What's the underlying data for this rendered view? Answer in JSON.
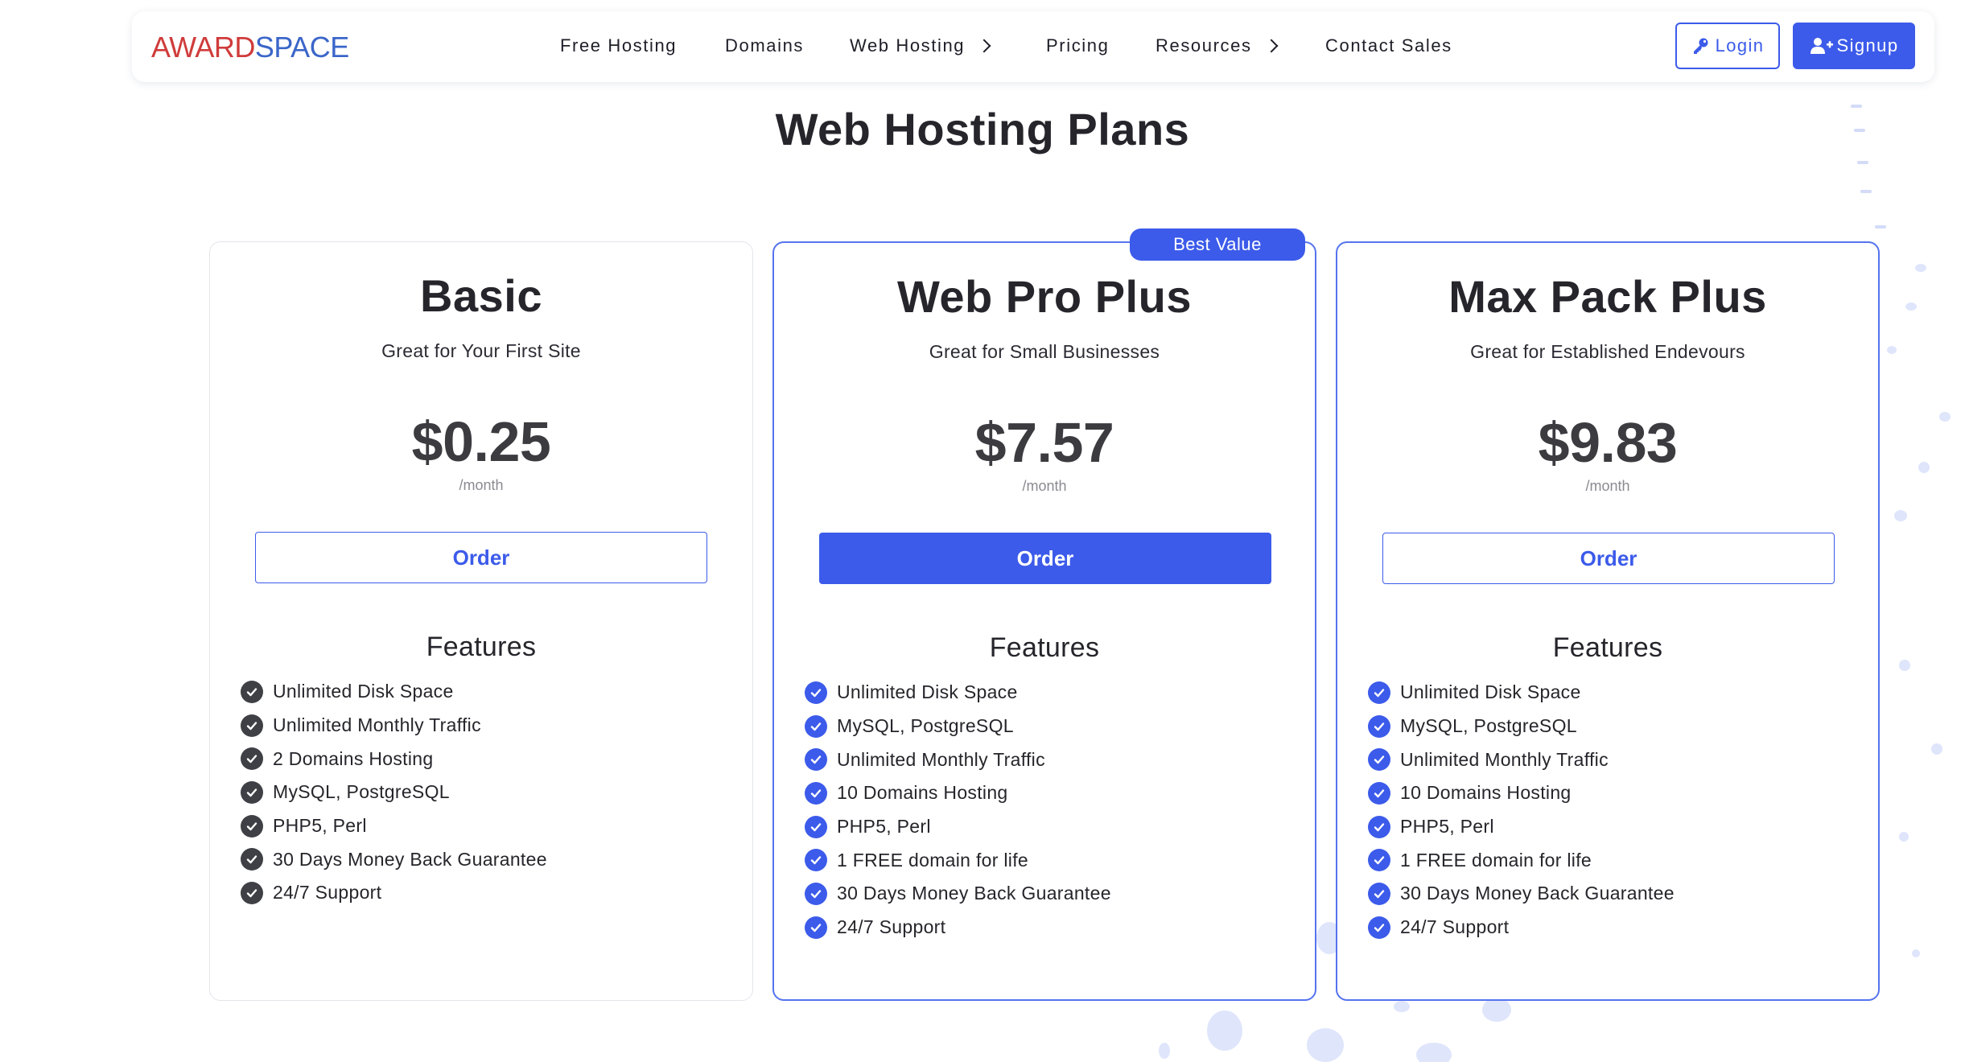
{
  "brand": {
    "logo_part1": "AWARD",
    "logo_part2": "SPACE"
  },
  "nav": {
    "items": [
      {
        "label": "Free Hosting",
        "has_chevron": false
      },
      {
        "label": "Domains",
        "has_chevron": false
      },
      {
        "label": "Web Hosting",
        "has_chevron": true
      },
      {
        "label": "Pricing",
        "has_chevron": false
      },
      {
        "label": "Resources",
        "has_chevron": true
      },
      {
        "label": "Contact Sales",
        "has_chevron": false
      }
    ],
    "login_label": "Login",
    "signup_label": "Signup"
  },
  "page": {
    "title": "Web Hosting Plans"
  },
  "plans": [
    {
      "name": "Basic",
      "subtitle": "Great for Your First Site",
      "price": "$0.25",
      "period": "/month",
      "order_label": "Order",
      "features_title": "Features",
      "features": [
        "Unlimited Disk Space",
        "Unlimited Monthly Traffic",
        "2 Domains Hosting",
        "MySQL, PostgreSQL",
        "PHP5, Perl",
        "30 Days Money Back Guarantee",
        "24/7 Support"
      ]
    },
    {
      "name": "Web Pro Plus",
      "subtitle": "Great for Small Businesses",
      "badge": "Best Value",
      "price": "$7.57",
      "period": "/month",
      "order_label": "Order",
      "features_title": "Features",
      "features": [
        "Unlimited Disk Space",
        "MySQL, PostgreSQL",
        "Unlimited Monthly Traffic",
        "10 Domains Hosting",
        "PHP5, Perl",
        "1 FREE domain for life",
        "30 Days Money Back Guarantee",
        "24/7 Support"
      ]
    },
    {
      "name": "Max Pack Plus",
      "subtitle": "Great for Established Endevours",
      "price": "$9.83",
      "period": "/month",
      "order_label": "Order",
      "features_title": "Features",
      "features": [
        "Unlimited Disk Space",
        "MySQL, PostgreSQL",
        "Unlimited Monthly Traffic",
        "10 Domains Hosting",
        "PHP5, Perl",
        "1 FREE domain for life",
        "30 Days Money Back Guarantee",
        "24/7 Support"
      ]
    }
  ],
  "colors": {
    "accent": "#3c5bea",
    "logo_red": "#d03b3b",
    "logo_blue": "#3b66c9",
    "check_dark": "#3f4046"
  }
}
